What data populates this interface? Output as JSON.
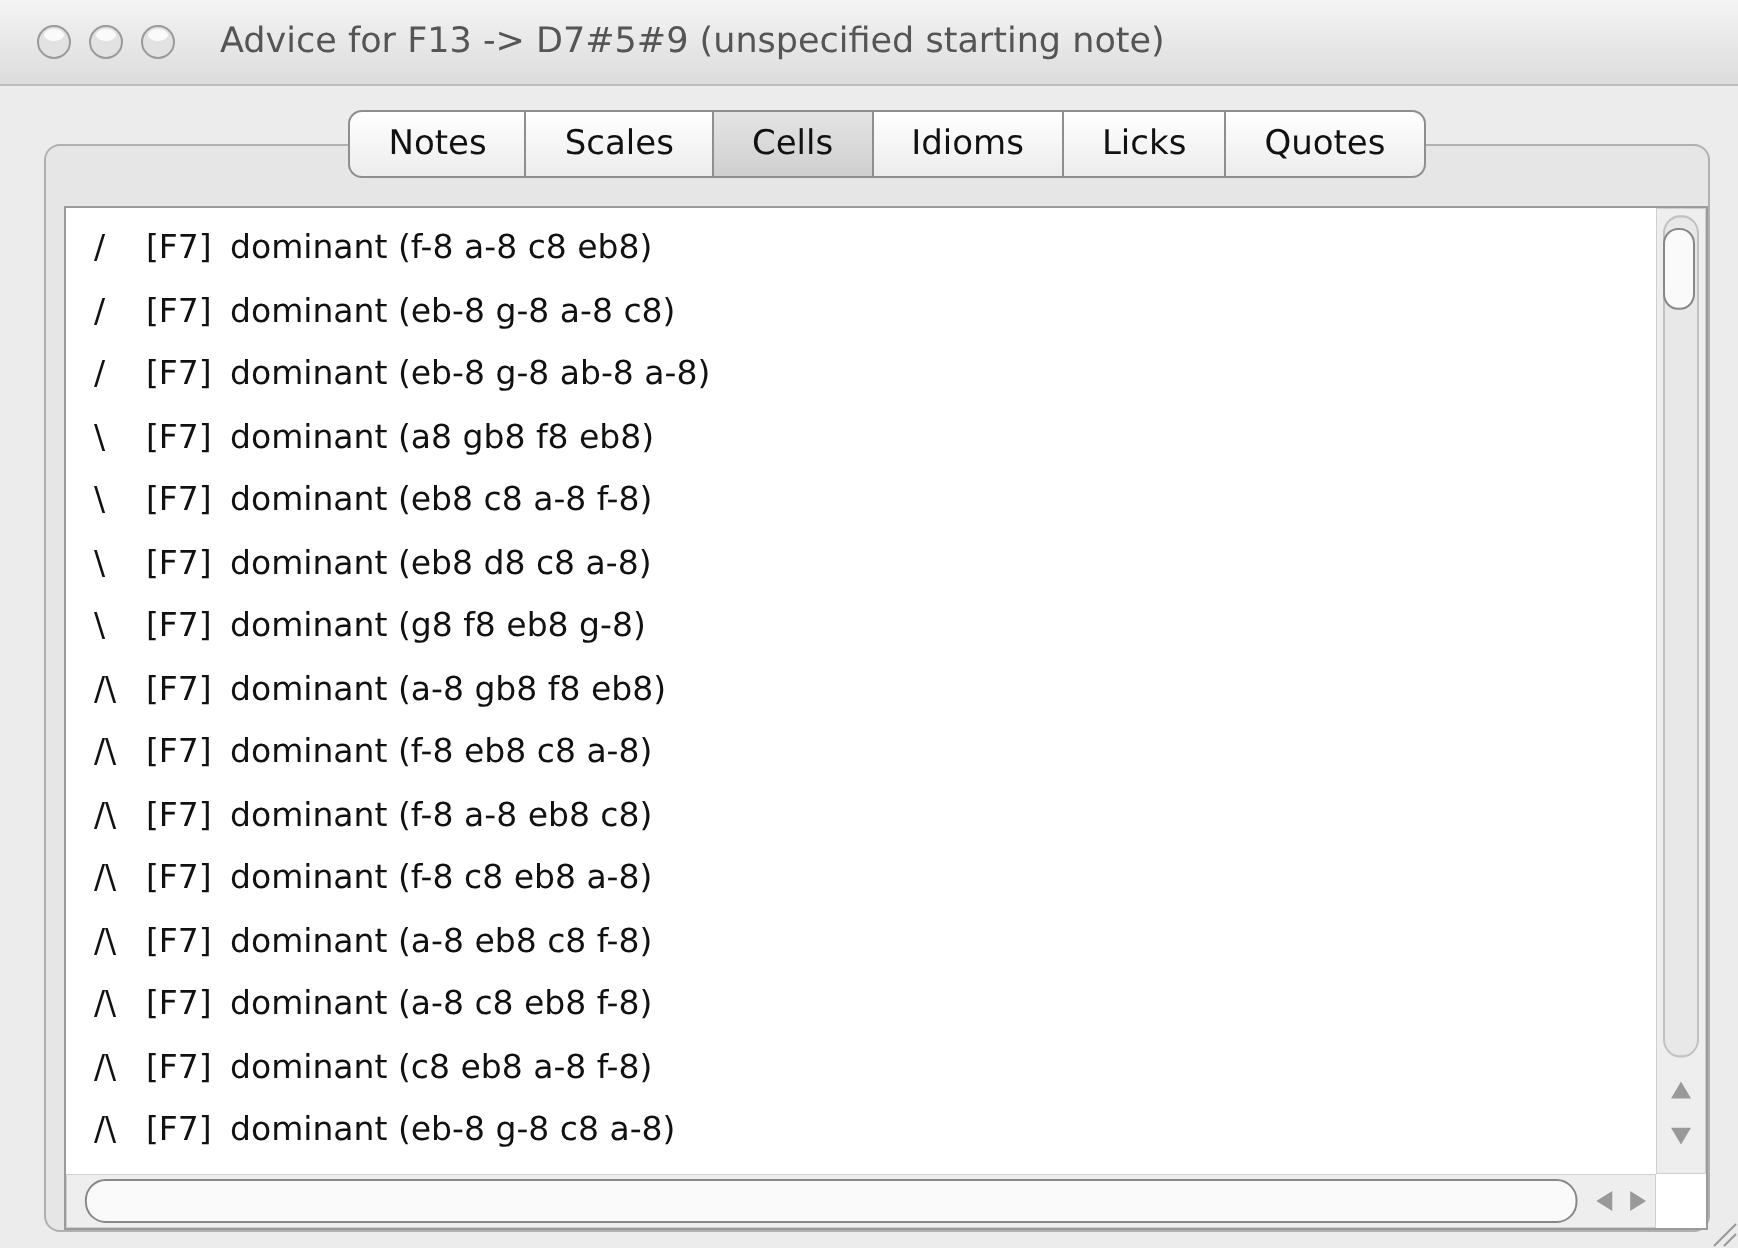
{
  "window": {
    "title": "Advice for F13 -> D7#5#9 (unspecified starting note)"
  },
  "tabs": [
    {
      "label": "Notes",
      "selected": false
    },
    {
      "label": "Scales",
      "selected": false
    },
    {
      "label": "Cells",
      "selected": true
    },
    {
      "label": "Idioms",
      "selected": false
    },
    {
      "label": "Licks",
      "selected": false
    },
    {
      "label": "Quotes",
      "selected": false
    }
  ],
  "list": {
    "rows": [
      {
        "contour": "/",
        "chord": "[F7]",
        "text": "dominant (f-8 a-8 c8 eb8)"
      },
      {
        "contour": "/",
        "chord": "[F7]",
        "text": "dominant (eb-8 g-8 a-8 c8)"
      },
      {
        "contour": "/",
        "chord": "[F7]",
        "text": "dominant (eb-8 g-8 ab-8 a-8)"
      },
      {
        "contour": "\\",
        "chord": "[F7]",
        "text": "dominant (a8 gb8 f8 eb8)"
      },
      {
        "contour": "\\",
        "chord": "[F7]",
        "text": "dominant (eb8 c8 a-8 f-8)"
      },
      {
        "contour": "\\",
        "chord": "[F7]",
        "text": "dominant (eb8 d8 c8 a-8)"
      },
      {
        "contour": "\\",
        "chord": "[F7]",
        "text": "dominant (g8 f8 eb8 g-8)"
      },
      {
        "contour": "/\\",
        "chord": "[F7]",
        "text": "dominant (a-8 gb8 f8 eb8)"
      },
      {
        "contour": "/\\",
        "chord": "[F7]",
        "text": "dominant (f-8 eb8 c8 a-8)"
      },
      {
        "contour": "/\\",
        "chord": "[F7]",
        "text": "dominant (f-8 a-8 eb8 c8)"
      },
      {
        "contour": "/\\",
        "chord": "[F7]",
        "text": "dominant (f-8 c8 eb8 a-8)"
      },
      {
        "contour": "/\\",
        "chord": "[F7]",
        "text": "dominant (a-8 eb8 c8 f-8)"
      },
      {
        "contour": "/\\",
        "chord": "[F7]",
        "text": "dominant (a-8 c8 eb8 f-8)"
      },
      {
        "contour": "/\\",
        "chord": "[F7]",
        "text": "dominant (c8 eb8 a-8 f-8)"
      },
      {
        "contour": "/\\",
        "chord": "[F7]",
        "text": "dominant (eb-8 g-8 c8 a-8)"
      }
    ]
  }
}
